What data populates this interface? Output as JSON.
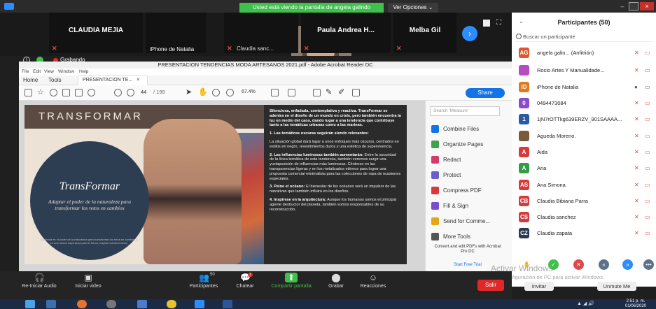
{
  "zoom": {
    "share_banner": "Usted está viendo la pantalla de angela galindo",
    "view_options": "Ver Opciones ⌄",
    "tiles": [
      {
        "name": "CLAUDIA MEJIA"
      },
      {
        "name": "iPhone de Natalia"
      },
      {
        "name": "Claudia sanc..."
      },
      {
        "name": "Paula Andrea H..."
      },
      {
        "name": "Melba Gil"
      }
    ],
    "recording_label": "Grabando",
    "bottom_bar": {
      "audio": "Re-Iniciar Audio",
      "video": "Iniciar video",
      "participants": "Participantes",
      "participants_count": "50",
      "chat": "Chatear",
      "chat_badge": "1",
      "share": "Compartir pantalla",
      "record": "Grabar",
      "reactions": "Reacciones",
      "leave": "Salir"
    }
  },
  "acrobat": {
    "title": "PRESENTACION TENDENCIAS MODA ARTESANOS 2021.pdf - Adobe Acrobat Reader DC",
    "menu": [
      "File",
      "Edit",
      "View",
      "Window",
      "Help"
    ],
    "tabs": {
      "home": "Home",
      "tools": "Tools",
      "doc": "PRESENTACION TE...",
      "close": "×"
    },
    "page_current": "44",
    "page_total": "/ 199",
    "zoom_level": "67.4%",
    "share": "Share",
    "tools_search_placeholder": "Search 'Measure'",
    "tools": [
      {
        "label": "Combine Files",
        "color": "#1473e6"
      },
      {
        "label": "Organize Pages",
        "color": "#3fa34d"
      },
      {
        "label": "Redact",
        "color": "#d63a6a"
      },
      {
        "label": "Protect",
        "color": "#6b5ccf"
      },
      {
        "label": "Compress PDF",
        "color": "#d63a3a"
      },
      {
        "label": "Fill & Sign",
        "color": "#7a4ccf"
      },
      {
        "label": "Send for Comme...",
        "color": "#e6a514"
      },
      {
        "label": "More Tools",
        "color": "#555555"
      }
    ],
    "promo": "Convert and edit PDFs with Acrobat Pro DC",
    "trial": "Start Free Trial"
  },
  "slide": {
    "heading": "TRANSFORMAR",
    "circle_title": "TransFormar",
    "circle_subtitle": "Adaptar el poder de la naturaleza para transformar los retos en cambios",
    "circle_footnote": "Inspirada en el poder de la naturaleza para transformar los retos en cambios y en una nueva esperanza para el futuro, inspira nuevas formas.",
    "intro": "Silenciosa, enfadada, contemplativa y reactiva. TransFormar se adentra en el diseño de un mundo en crisis, pero también encuentra la luz en medio del caos, dando lugar a una tendencia que contribuye tanto a las temáticas urbanas como a las marinas.",
    "p1_title": "1. Las temáticas oscuras seguirán siendo relevantes:",
    "p1": "La situación global dará lugar a unos enfoques más oscuros, centrados en estilos en negro, revestimientos duros y una estética de supervivencia.",
    "p2_title": "2. Las influencias luminosas también aumentarán:",
    "p2": "Entre la oscuridad de la línea temática de esta tendencia, también veremos surgir una yuxtaposición de influencias más luminosas. Céntrese en las transparencias ligeras y en los metalizados etéreos para lograr una propuesta comercial minimalista para las colecciones de ropa de ocasiones especiales.",
    "p3_title": "3. Peine el océano:",
    "p3": "El bienestar de los océanos será un impulsor de las narrativas que también influirá en los diseños.",
    "p4_title": "4. Inspírese en la arquitectura:",
    "p4": "Aunque los humanos somos el principal agente destructor del planeta, también somos responsables de su reconstrucción."
  },
  "participants": {
    "title": "Participantes (50)",
    "search_placeholder": "Buscar un participante",
    "list": [
      {
        "initials": "AG",
        "name": "angela galin... (Anfitrión)",
        "color": "#e0562c"
      },
      {
        "initials": "",
        "name": "Rocio Artes Y Manualidade...",
        "color": "#b84ac2"
      },
      {
        "initials": "ID",
        "name": "iPhone de Natalia",
        "color": "#e07a1f"
      },
      {
        "initials": "0",
        "name": "0494473084",
        "color": "#8a4cc8"
      },
      {
        "initials": "1",
        "name": "1jN7rOTTkg639ERZV_901SAAAA...",
        "color": "#2c5aa0"
      },
      {
        "initials": "",
        "name": "Agueda Moreno.",
        "color": "#7a5a3a"
      },
      {
        "initials": "A",
        "name": "Aida",
        "color": "#d63a3a"
      },
      {
        "initials": "A",
        "name": "Ana",
        "color": "#2f9e44"
      },
      {
        "initials": "AS",
        "name": "Ana Simona",
        "color": "#d63a3a"
      },
      {
        "initials": "CB",
        "name": "Claudia Bibiana Parra",
        "color": "#d63a3a"
      },
      {
        "initials": "CS",
        "name": "Claudia sanchez",
        "color": "#d63a3a"
      },
      {
        "initials": "CZ",
        "name": "Claudia zapata",
        "color": "#2c3a52"
      }
    ],
    "invite": "Invitar",
    "mute_all": "Unmute Me"
  },
  "windows": {
    "activate_line1": "Activar Windows",
    "activate_line2": "Ve a Configuración de PC para activar Windows.",
    "time": "2:51 p. m.",
    "date": "01/06/2020"
  }
}
